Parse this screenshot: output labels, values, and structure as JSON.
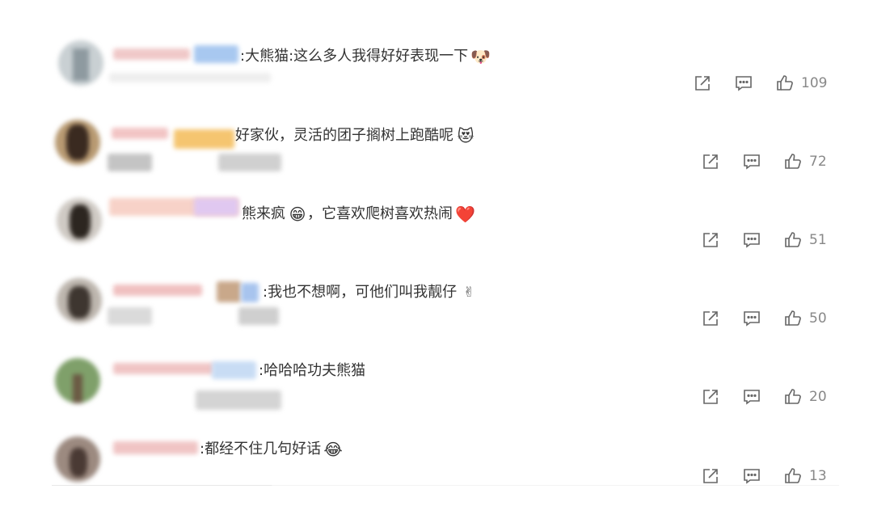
{
  "comments": [
    {
      "text": ":大熊猫:这么多人我得好好表现一下",
      "emoji": "🐶",
      "likes": "109"
    },
    {
      "text": "好家伙，灵活的团子搁树上跑酷呢",
      "emoji": "😻",
      "likes": "72"
    },
    {
      "text": "熊来疯",
      "emoji": "😁",
      "text2": "，它喜欢爬树喜欢热闹",
      "emoji2": "❤️",
      "likes": "51"
    },
    {
      "text": ":我也不想啊，可他们叫我靓仔",
      "emoji": "✌",
      "likes": "50"
    },
    {
      "text": ":哈哈哈功夫熊猫",
      "likes": "20"
    },
    {
      "text": ":都经不住几句好话",
      "emoji": "😂",
      "likes": "13"
    }
  ],
  "colors": {
    "text": "#333333",
    "icon": "#666666",
    "count": "#888888"
  },
  "icons": [
    "share-icon",
    "comment-icon",
    "like-icon"
  ]
}
